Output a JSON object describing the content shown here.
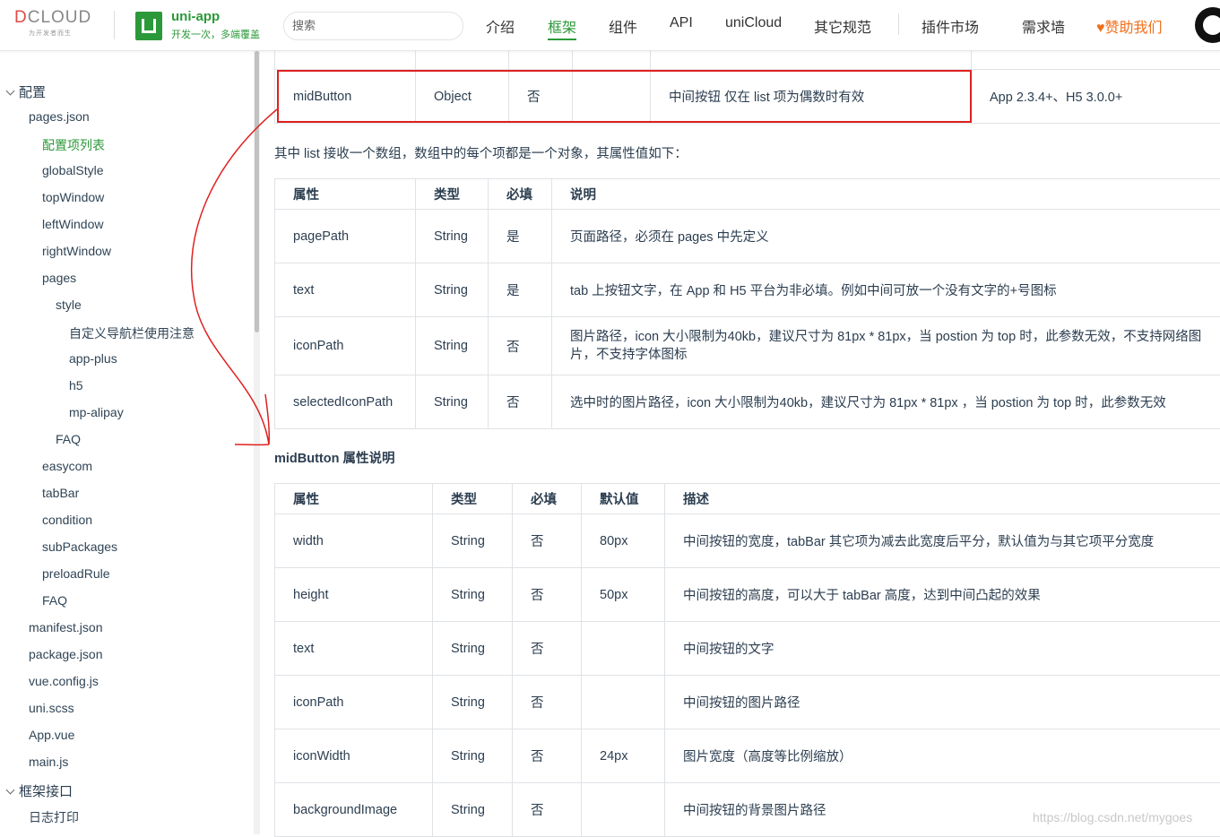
{
  "header": {
    "dcloud_logo": "DCLOUD",
    "dcloud_tagline": "为开发者而生",
    "uniapp_name": "uni-app",
    "uniapp_slogan": "开发一次，多端覆盖",
    "search_placeholder": "搜索",
    "nav": [
      "介绍",
      "框架",
      "组件",
      "API",
      "uniCloud",
      "其它规范",
      "插件市场",
      "需求墙",
      "♥赞助我们"
    ],
    "active_nav": "框架",
    "colors": {
      "brand": "#2b9939",
      "sponsor": "#f06f1a"
    }
  },
  "sidebar": {
    "items": [
      {
        "label": "配置",
        "level": 0,
        "group": true
      },
      {
        "label": "pages.json",
        "level": 1
      },
      {
        "label": "配置项列表",
        "level": 2,
        "active": true
      },
      {
        "label": "globalStyle",
        "level": 2
      },
      {
        "label": "topWindow",
        "level": 2
      },
      {
        "label": "leftWindow",
        "level": 2
      },
      {
        "label": "rightWindow",
        "level": 2
      },
      {
        "label": "pages",
        "level": 2
      },
      {
        "label": "style",
        "level": 3
      },
      {
        "label": "自定义导航栏使用注意",
        "level": 4
      },
      {
        "label": "app-plus",
        "level": 4
      },
      {
        "label": "h5",
        "level": 4
      },
      {
        "label": "mp-alipay",
        "level": 4
      },
      {
        "label": "FAQ",
        "level": 3
      },
      {
        "label": "easycom",
        "level": 2
      },
      {
        "label": "tabBar",
        "level": 2
      },
      {
        "label": "condition",
        "level": 2
      },
      {
        "label": "subPackages",
        "level": 2
      },
      {
        "label": "preloadRule",
        "level": 2
      },
      {
        "label": "FAQ",
        "level": 2
      },
      {
        "label": "manifest.json",
        "level": 1
      },
      {
        "label": "package.json",
        "level": 1
      },
      {
        "label": "vue.config.js",
        "level": 1
      },
      {
        "label": "uni.scss",
        "level": 1
      },
      {
        "label": "App.vue",
        "level": 1
      },
      {
        "label": "main.js",
        "level": 1
      },
      {
        "label": "框架接口",
        "level": 0,
        "group": true
      },
      {
        "label": "日志打印",
        "level": 1
      }
    ]
  },
  "table_top": {
    "row": [
      "midButton",
      "Object",
      "否",
      "",
      "中间按钮 仅在 list 项为偶数时有效",
      "App 2.3.4+、H5 3.0.0+"
    ]
  },
  "list_intro": "其中 list 接收一个数组，数组中的每个项都是一个对象，其属性值如下：",
  "list_table": {
    "headers": [
      "属性",
      "类型",
      "必填",
      "说明"
    ],
    "rows": [
      [
        "pagePath",
        "String",
        "是",
        "页面路径，必须在 pages 中先定义"
      ],
      [
        "text",
        "String",
        "是",
        "tab 上按钮文字，在 App 和 H5 平台为非必填。例如中间可放一个没有文字的+号图标"
      ],
      [
        "iconPath",
        "String",
        "否",
        "图片路径，icon 大小限制为40kb，建议尺寸为 81px * 81px，当 postion 为 top 时，此参数无效，不支持网络图片，不支持字体图标"
      ],
      [
        "selectedIconPath",
        "String",
        "否",
        "选中时的图片路径，icon 大小限制为40kb，建议尺寸为 81px * 81px ，当 postion 为 top 时，此参数无效"
      ]
    ]
  },
  "midbutton_heading": "midButton 属性说明",
  "mid_table": {
    "headers": [
      "属性",
      "类型",
      "必填",
      "默认值",
      "描述"
    ],
    "rows": [
      [
        "width",
        "String",
        "否",
        "80px",
        "中间按钮的宽度，tabBar 其它项为减去此宽度后平分，默认值为与其它项平分宽度"
      ],
      [
        "height",
        "String",
        "否",
        "50px",
        "中间按钮的高度，可以大于 tabBar 高度，达到中间凸起的效果"
      ],
      [
        "text",
        "String",
        "否",
        "",
        "中间按钮的文字"
      ],
      [
        "iconPath",
        "String",
        "否",
        "",
        "中间按钮的图片路径"
      ],
      [
        "iconWidth",
        "String",
        "否",
        "24px",
        "图片宽度（高度等比例缩放）"
      ],
      [
        "backgroundImage",
        "String",
        "否",
        "",
        "中间按钮的背景图片路径"
      ]
    ]
  },
  "watermark": "https://blog.csdn.net/mygoes",
  "annotation_color": "#e02020"
}
